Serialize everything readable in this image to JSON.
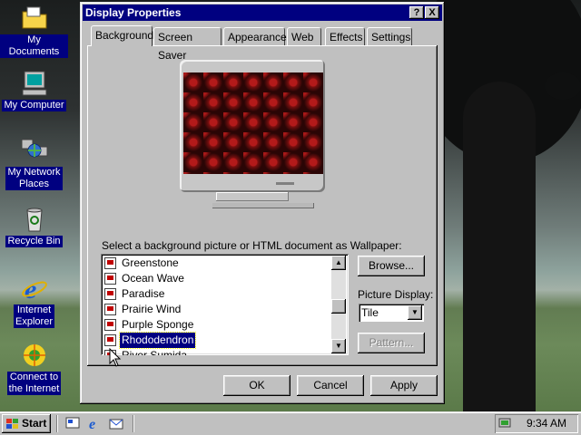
{
  "desktop": {
    "icons": [
      {
        "label": "My Documents",
        "icon": "folder-icon"
      },
      {
        "label": "My Computer",
        "icon": "computer-icon"
      },
      {
        "label_lines": [
          "My Network",
          "Places"
        ],
        "icon": "network-icon"
      },
      {
        "label": "Recycle Bin",
        "icon": "recycle-bin-icon"
      },
      {
        "label_lines": [
          "Internet",
          "Explorer"
        ],
        "icon": "ie-icon"
      },
      {
        "label_lines": [
          "Connect to",
          "the Internet"
        ],
        "icon": "connect-icon"
      }
    ]
  },
  "dialog": {
    "title": "Display Properties",
    "help_btn": "?",
    "close_btn": "X",
    "tabs": [
      "Background",
      "Screen Saver",
      "Appearance",
      "Web",
      "Effects",
      "Settings"
    ],
    "active_tab": "Background",
    "wallpaper_label": "Select a background picture or HTML document as Wallpaper:",
    "wallpaper_list": [
      {
        "name": "Greenstone",
        "selected": false
      },
      {
        "name": "Ocean Wave",
        "selected": false
      },
      {
        "name": "Paradise",
        "selected": false
      },
      {
        "name": "Prairie Wind",
        "selected": false
      },
      {
        "name": "Purple Sponge",
        "selected": false
      },
      {
        "name": "Rhododendron",
        "selected": true
      },
      {
        "name": "River Sumida",
        "selected": false
      }
    ],
    "browse_label": "Browse...",
    "picture_display_label": "Picture Display:",
    "picture_display_value": "Tile",
    "pattern_label": "Pattern...",
    "ok_label": "OK",
    "cancel_label": "Cancel",
    "apply_label": "Apply"
  },
  "taskbar": {
    "start_label": "Start",
    "quick_launch": [
      "show-desktop-icon",
      "ie-icon",
      "outlook-express-icon"
    ],
    "clock": "9:34 AM"
  },
  "colors": {
    "titlebar": "#000080",
    "desktop_teal": "#008080",
    "selection": "#000080"
  }
}
